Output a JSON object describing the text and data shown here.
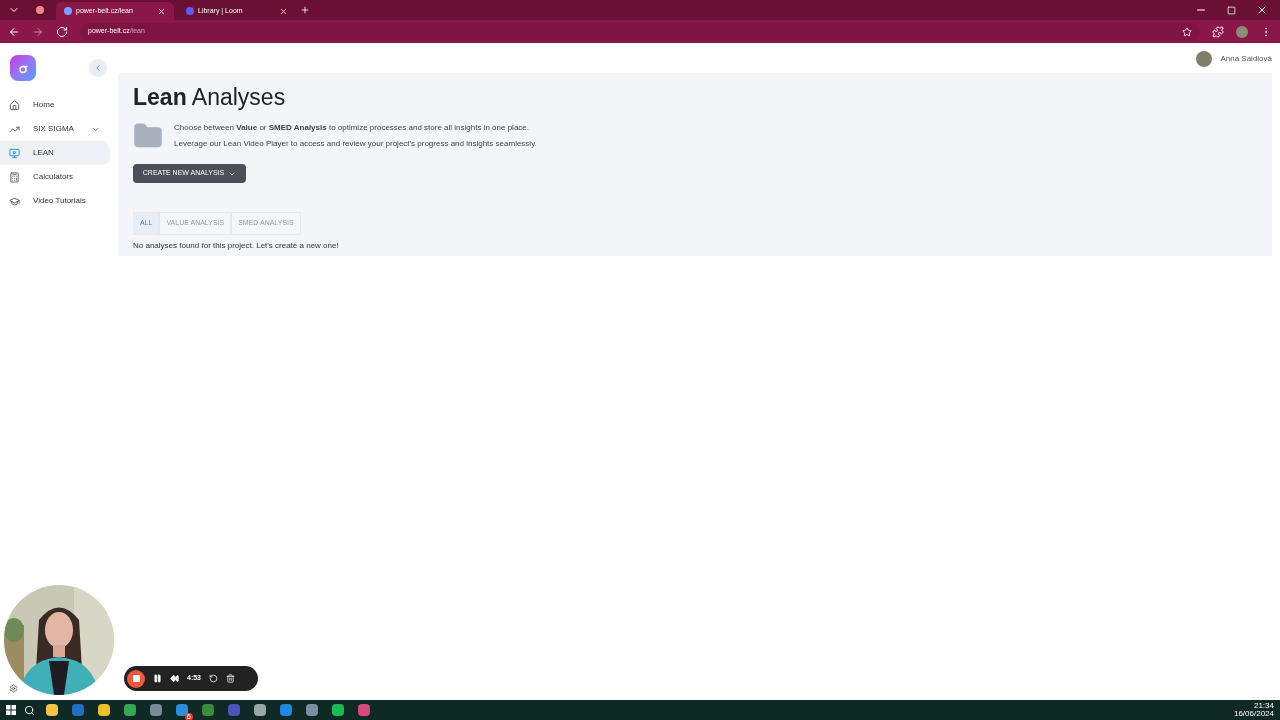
{
  "browser": {
    "tabs": [
      {
        "title": "power-belt.cz/lean",
        "selected": true
      },
      {
        "title": "Library | Loom",
        "selected": false
      }
    ],
    "url_host": "power-belt.cz",
    "url_path": "/lean"
  },
  "sidebar": {
    "items": [
      {
        "label": "Home",
        "kind": "link",
        "selected": false
      },
      {
        "label": "SIX SIGMA",
        "kind": "group",
        "selected": false
      },
      {
        "label": "LEAN",
        "kind": "link",
        "selected": true
      },
      {
        "label": "Calculators",
        "kind": "link",
        "selected": false
      },
      {
        "label": "Video Tutorials",
        "kind": "link",
        "selected": false
      }
    ]
  },
  "user": {
    "name": "Anna Saidlová"
  },
  "page": {
    "title": "**Lean** Analyses",
    "description": [
      "Choose between **Value** or **SMED Analysis** to optimize processes and store all insights in one place.",
      "Leverage our Lean Video Player to access and review your project's progress and insights seamlessly."
    ],
    "create_button": "CREATE NEW ANALYSIS",
    "filters": [
      {
        "label": "ALL",
        "selected": true
      },
      {
        "label": "VALUE ANALYSIS",
        "selected": false
      },
      {
        "label": "SMED ANALYSIS",
        "selected": false
      }
    ],
    "empty_message": "No analyses found for this project. Let's create a new one!"
  },
  "recorder": {
    "time": "4:53"
  },
  "taskbar": {
    "badge": "6",
    "time": "21:34",
    "date": "16/06/2024"
  }
}
